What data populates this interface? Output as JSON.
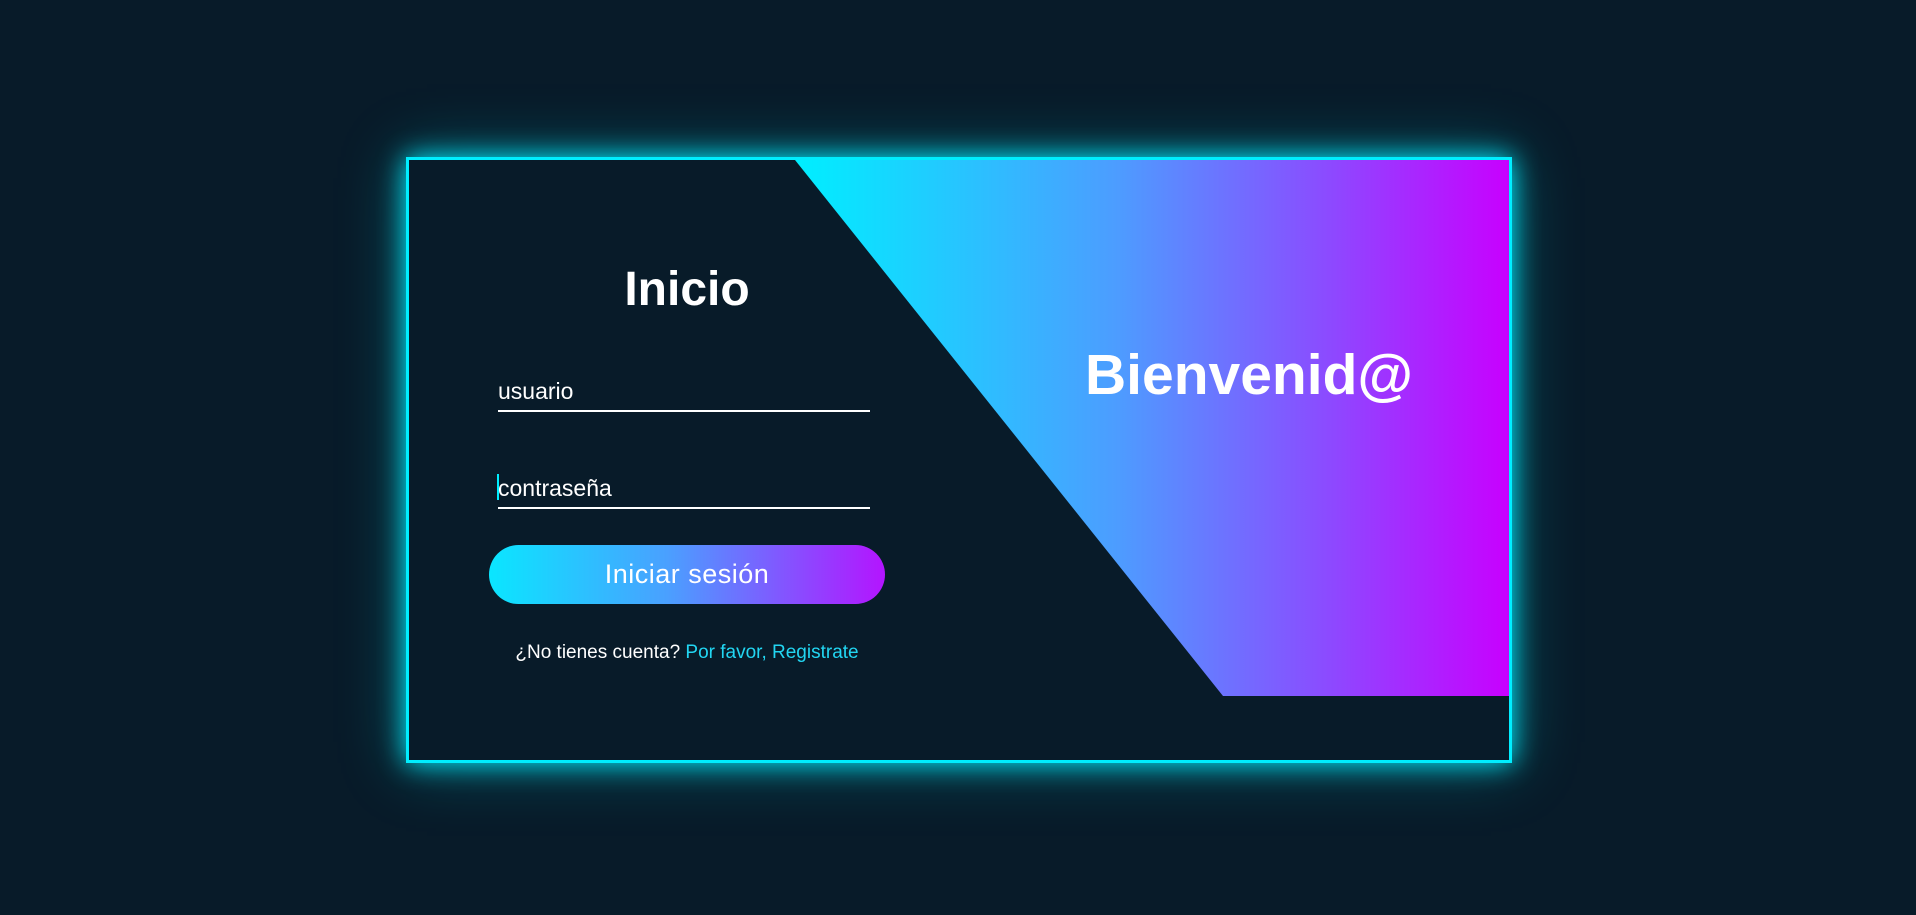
{
  "login": {
    "title": "Inicio",
    "username_placeholder": "usuario",
    "password_placeholder": "contraseña",
    "submit_label": "Iniciar sesión",
    "signup_prompt": "¿No tienes cuenta?",
    "signup_link": "Por favor, Registrate"
  },
  "welcome": {
    "text": "Bienvenid@"
  },
  "colors": {
    "background": "#081b29",
    "accent_cyan": "#00eeff",
    "accent_magenta": "#c800ff"
  }
}
